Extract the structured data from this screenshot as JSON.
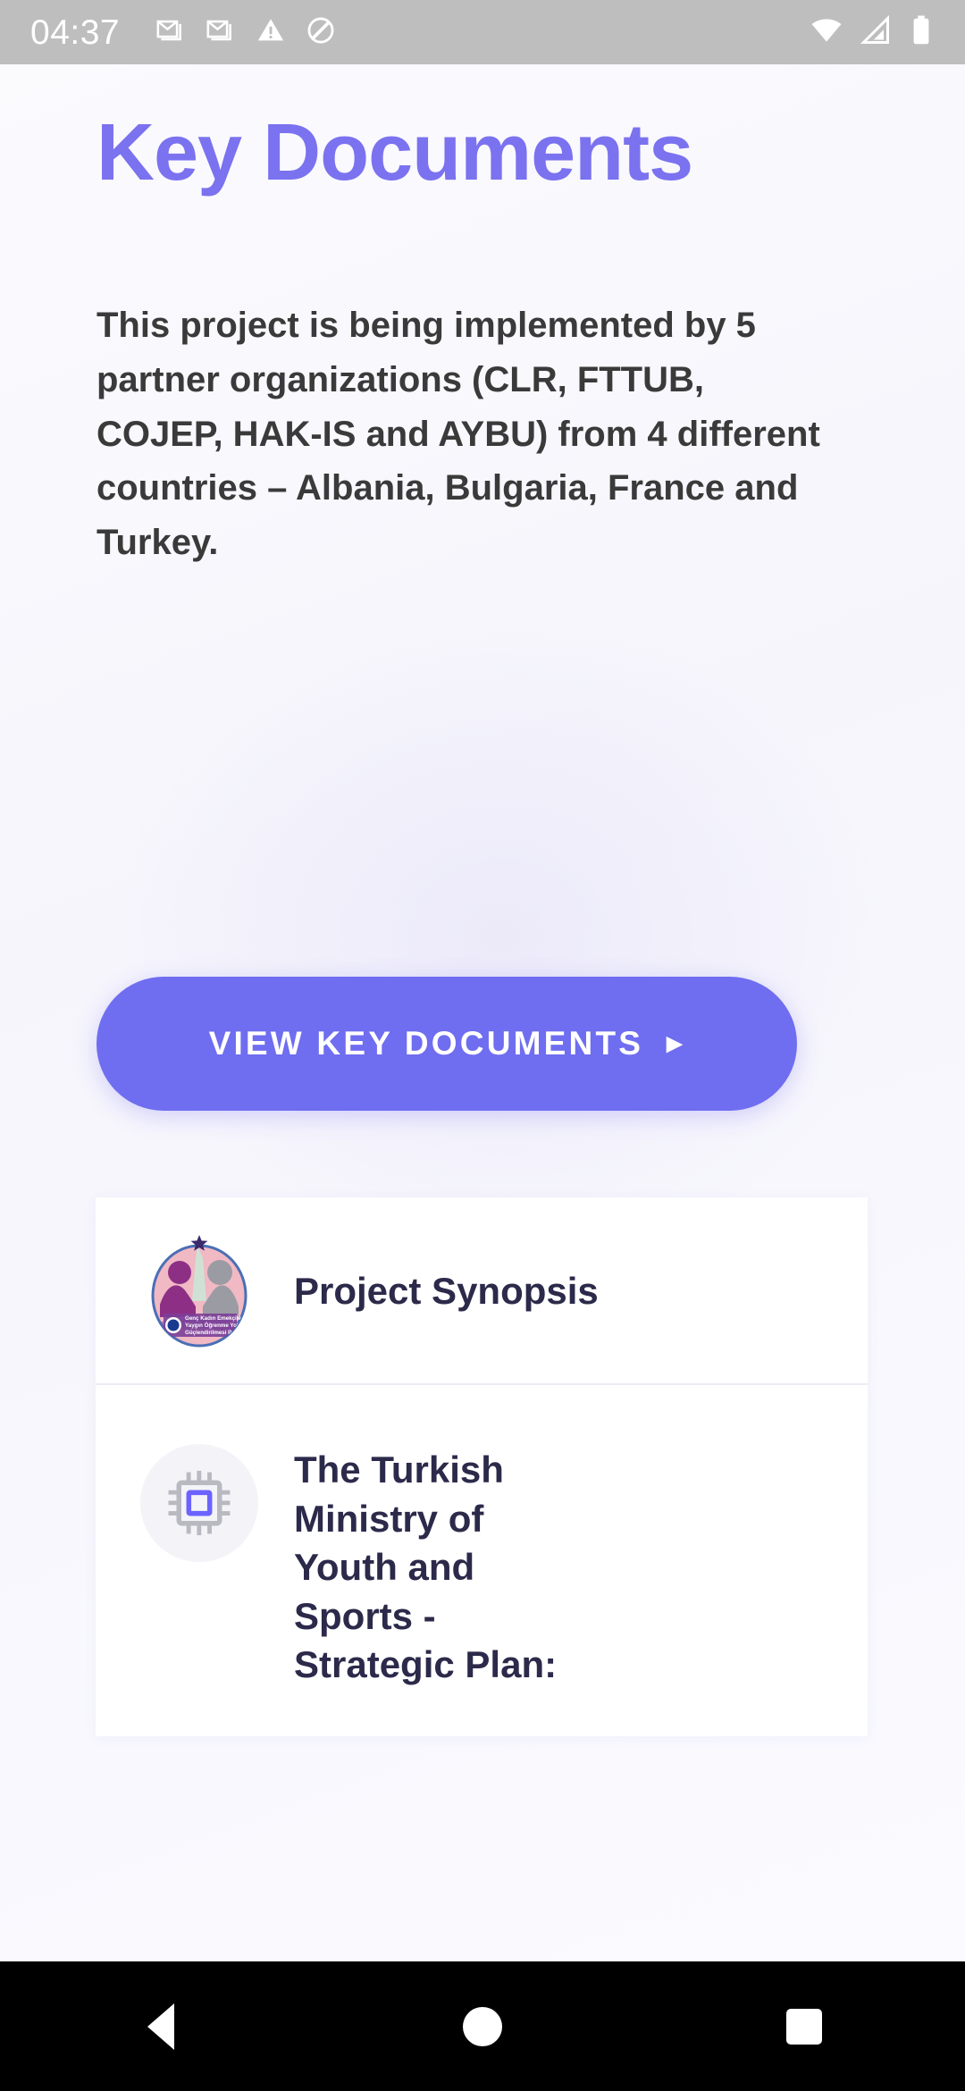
{
  "status_bar": {
    "time": "04:37",
    "left_icons": [
      "gmail-icon",
      "gmail-icon",
      "warning-triangle-icon",
      "do-not-disturb-icon"
    ],
    "right_icons": [
      "wifi-icon",
      "cellular-signal-icon",
      "battery-icon"
    ],
    "background_color": "#bebebe",
    "icon_color": "#ffffff"
  },
  "page": {
    "title": "Key Documents",
    "title_color": "#7b72f0",
    "intro_paragraph": "This project is being implemented by 5 partner organizations (CLR, FTTUB, COJEP, HAK-IS and AYBU) from 4 different countries – Albania, Bulgaria, France and Turkey.",
    "intro_color": "#3a3a3a",
    "background_color": "#f7f6fd"
  },
  "cta": {
    "label": "VIEW KEY DOCUMENTS",
    "arrow": "▸",
    "background_color": "#6f6df0",
    "text_color": "#ffffff"
  },
  "documents": {
    "title_color": "#2c2a4a",
    "items": [
      {
        "title": "Project Synopsis",
        "icon": "project-logo-oval",
        "logo_text_lines": [
          "Genç Kadın Emekçilerin",
          "Yaygın Öğrenme Yoluyla",
          "Güçlendirilmesi Projesi"
        ]
      },
      {
        "title": "The Turkish Ministry of Youth and Sports - Strategic Plan:",
        "icon": "microchip-icon",
        "icon_accent_color": "#6c63ff"
      }
    ]
  },
  "nav_bar": {
    "background_color": "#000000",
    "buttons": [
      "back-button",
      "home-button",
      "recents-button"
    ]
  }
}
